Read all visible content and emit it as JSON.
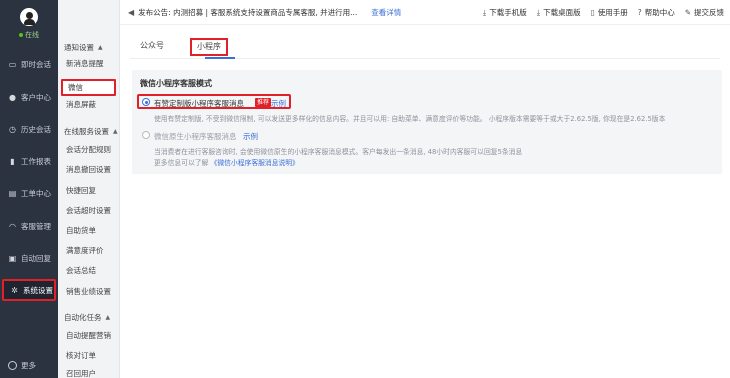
{
  "sidebar": {
    "status": "在线",
    "items": [
      {
        "label": "即时会话",
        "icon": "chat-icon"
      },
      {
        "label": "客户中心",
        "icon": "user-icon"
      },
      {
        "label": "历史会话",
        "icon": "clock-icon"
      },
      {
        "label": "工作报表",
        "icon": "bar-chart-icon"
      },
      {
        "label": "工单中心",
        "icon": "ticket-icon"
      },
      {
        "label": "客服管理",
        "icon": "headset-icon"
      },
      {
        "label": "自动回复",
        "icon": "robot-icon"
      },
      {
        "label": "系统设置",
        "icon": "gear-icon"
      }
    ],
    "more": "更多"
  },
  "submenu": {
    "group_notify": "通知设置",
    "new_message": "新消息提醒",
    "wechat": "微信",
    "message_mask": "消息屏蔽",
    "group_online": "在线服务设置",
    "session_dispatch": "会话分配规则",
    "message_recall": "消息撤回设置",
    "quick_reply": "快捷回复",
    "session_timeout": "会话超时设置",
    "auto_ticket": "自助货单",
    "satisfaction": "满意度评价",
    "session_summary": "会话总结",
    "sales_setting": "销售业绩设置",
    "group_automation": "自动化任务",
    "auto_remind": "自动提醒营销",
    "verify_order": "核对订单",
    "recall_customer": "召回用户"
  },
  "topbar": {
    "notice": "发布公告: 内测招募 | 客服系统支持设置商品专属客服, 并进行用...",
    "detail_link": "查看详情",
    "actions": [
      {
        "label": "下载手机版",
        "icon": "download-icon"
      },
      {
        "label": "下载桌面版",
        "icon": "download-icon"
      },
      {
        "label": "使用手册",
        "icon": "book-icon"
      },
      {
        "label": "帮助中心",
        "icon": "help-icon"
      },
      {
        "label": "提交反馈",
        "icon": "feedback-icon"
      }
    ]
  },
  "tabs": [
    {
      "label": "公众号",
      "active": false
    },
    {
      "label": "小程序",
      "active": true
    }
  ],
  "panel": {
    "title": "微信小程序客服模式",
    "option1": {
      "label": "有赞定制版小程序客服消息",
      "badge": "推荐",
      "example": "示例",
      "desc": "使用有赞定制版, 不受到微信限制, 可以发送更多样化的信息内容。并且可以用: 自助菜单、满意度评价等功能。 小程序版本需要等于或大于2.62.5版, 你现在是2.62.5版本"
    },
    "option2": {
      "label": "微信原生小程序客服消息",
      "example": "示例",
      "desc1": "当消费者在进行客服咨询时, 会使用微信原生的小程序客服消息模式。客户每发出一条消息, 48小时内客服可以回复5条消息",
      "desc2_prefix": "更多信息可以了解",
      "desc2_link": "《微信小程序客服消息说明》"
    }
  },
  "colors": {
    "sidebar_bg": "#2b3240",
    "accent": "#3a6fd8",
    "highlight_red": "#e0212a"
  }
}
